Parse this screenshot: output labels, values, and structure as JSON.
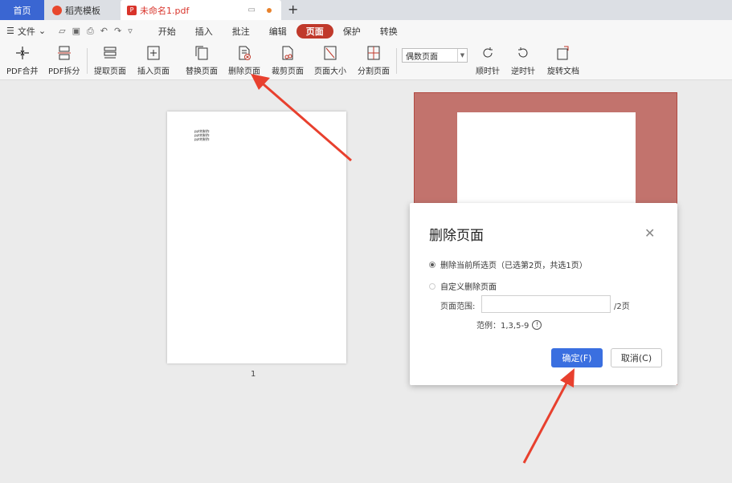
{
  "tabs": {
    "home": "首页",
    "template": "稻壳模板",
    "document": "未命名1.pdf",
    "add": "+"
  },
  "menubar": {
    "file": "文件",
    "items": [
      "开始",
      "插入",
      "批注",
      "编辑",
      "页面",
      "保护",
      "转换"
    ],
    "active_index": 4
  },
  "toolbar": {
    "pdf_merge": "PDF合并",
    "pdf_split": "PDF拆分",
    "extract_page": "提取页面",
    "insert_page": "插入页面",
    "replace_page": "替换页面",
    "delete_page": "删除页面",
    "crop_page": "裁剪页面",
    "page_size": "页面大小",
    "split_page": "分割页面",
    "page_select": "偶数页面",
    "clockwise": "顺时针",
    "counterclockwise": "逆时针",
    "rotate_doc": "旋转文档"
  },
  "workspace": {
    "page1_text_lines": [
      "ppt的制作",
      "ppt的制作",
      "ppt的制作"
    ],
    "page1_number": "1"
  },
  "dialog": {
    "title": "删除页面",
    "option_current": "删除当前所选页（已选第2页，共选1页）",
    "option_custom": "自定义删除页面",
    "range_label": "页面范围:",
    "range_value": "",
    "range_total": "/2页",
    "example": "范例：1,3,5-9",
    "ok": "确定(F)",
    "cancel": "取消(C)"
  },
  "colors": {
    "accent_blue": "#3a6fe0",
    "active_menu": "#c0392b",
    "selected_page": "#c2736d",
    "arrow": "#e8402e"
  }
}
